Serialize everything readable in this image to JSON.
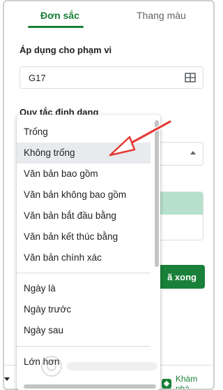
{
  "tabs": {
    "active": "Đơn sắc",
    "inactive": "Thang màu"
  },
  "range": {
    "label": "Áp dụng cho phạm vi",
    "value": "G17"
  },
  "rules": {
    "label": "Quy tắc định dạng"
  },
  "menu": {
    "items": [
      "Trống",
      "Không trống",
      "Văn bản bao gồm",
      "Văn bản không bao gồm",
      "Văn bản bắt đầu bằng",
      "Văn bản kết thúc bằng",
      "Văn bản chính xác",
      "Ngày là",
      "Ngày trước",
      "Ngày sau",
      "Lớn hơn"
    ],
    "selected_index": 1
  },
  "done_button": {
    "label": "ã xong"
  },
  "footer": {
    "explore_label": "Khám phá"
  },
  "colors": {
    "accent": "#188038",
    "preview_fill": "#b7e1cd",
    "annotation_arrow": "#e53935"
  },
  "icons": {
    "range_picker": "grid-icon",
    "dropdown": "caret-up-icon",
    "explore": "explore-icon"
  }
}
